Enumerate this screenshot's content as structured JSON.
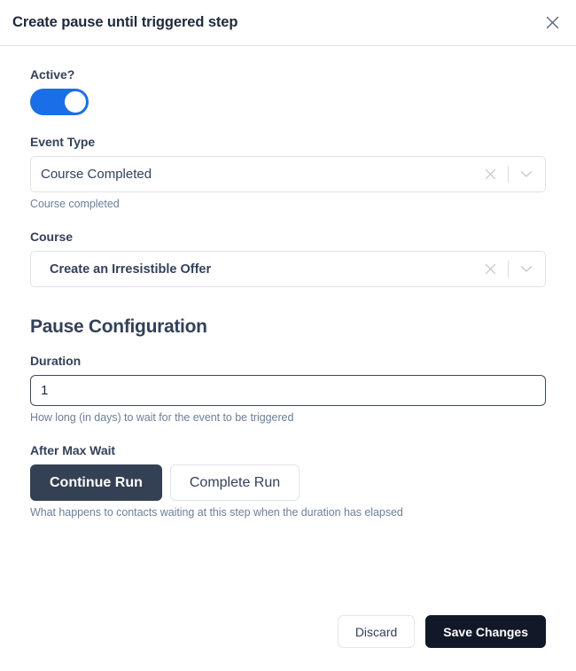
{
  "header": {
    "title": "Create pause until triggered step",
    "close_icon": "close-icon"
  },
  "form": {
    "active": {
      "label": "Active?",
      "state": "on"
    },
    "event_type": {
      "label": "Event Type",
      "value": "Course Completed",
      "helper": "Course completed",
      "clear_icon": "clear-icon",
      "chevron_icon": "chevron-down-icon"
    },
    "course": {
      "label": "Course",
      "value": "Create an Irresistible Offer",
      "clear_icon": "clear-icon",
      "chevron_icon": "chevron-down-icon"
    }
  },
  "pause_configuration": {
    "heading": "Pause Configuration",
    "duration": {
      "label": "Duration",
      "value": "1",
      "helper": "How long (in days) to wait for the event to be triggered"
    },
    "after_max_wait": {
      "label": "After Max Wait",
      "options": [
        {
          "label": "Continue Run",
          "selected": true
        },
        {
          "label": "Complete Run",
          "selected": false
        }
      ],
      "helper": "What happens to contacts waiting at this step when the duration has elapsed"
    }
  },
  "footer": {
    "discard_label": "Discard",
    "save_label": "Save Changes"
  },
  "colors": {
    "toggle_on": "#1a6fe8",
    "primary_dark": "#111827",
    "segment_selected": "#344054",
    "helper_text": "#6c7f9b"
  }
}
